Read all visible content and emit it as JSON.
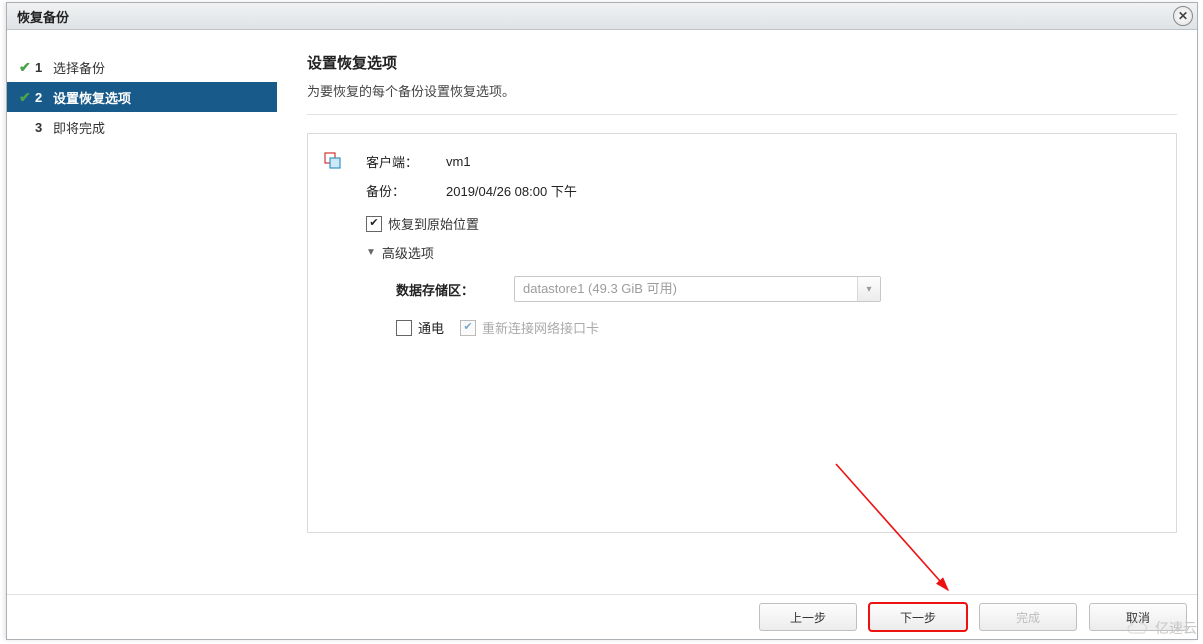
{
  "window": {
    "title": "恢复备份"
  },
  "steps": {
    "items": [
      {
        "num": "1",
        "label": "选择备份",
        "completed": true
      },
      {
        "num": "2",
        "label": "设置恢复选项",
        "active": true
      },
      {
        "num": "3",
        "label": "即将完成"
      }
    ]
  },
  "main": {
    "title": "设置恢复选项",
    "subtitle": "为要恢复的每个备份设置恢复选项。"
  },
  "panel": {
    "client_label": "客户端：",
    "client_value": "vm1",
    "backup_label": "备份：",
    "backup_value": "2019/04/26 08:00 下午",
    "restore_original_label": "恢复到原始位置",
    "advanced_label": "高级选项",
    "datastore_label": "数据存储区：",
    "datastore_value": "datastore1 (49.3 GiB 可用)",
    "power_on_label": "通电",
    "reconnect_nic_label": "重新连接网络接口卡"
  },
  "footer": {
    "prev": "上一步",
    "next": "下一步",
    "finish": "完成",
    "cancel": "取消"
  },
  "watermark": "亿速云"
}
